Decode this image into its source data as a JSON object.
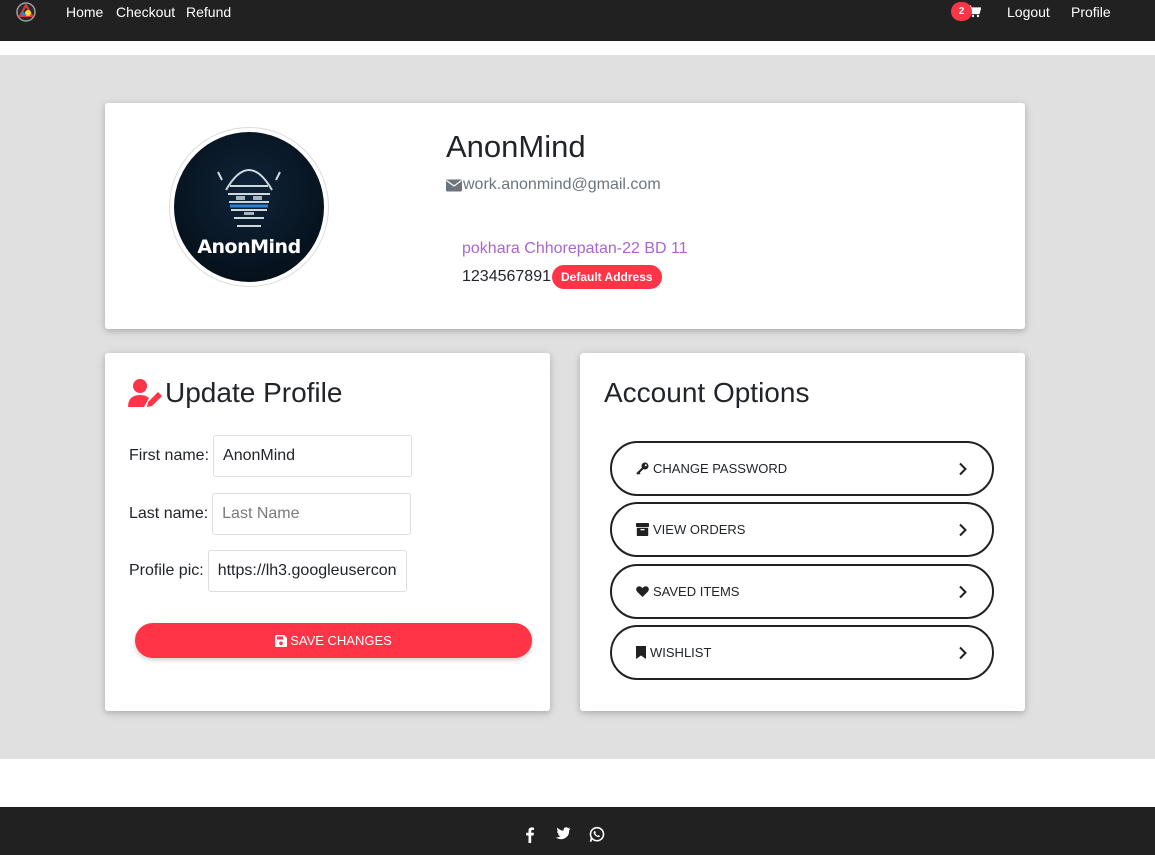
{
  "nav": {
    "logo_icon": "app-logo-icon",
    "links": [
      "Home",
      "Checkout",
      "Refund"
    ],
    "cart_count": "2",
    "cart_icon": "cart-icon",
    "logout": "Logout",
    "profile": "Profile"
  },
  "profile": {
    "avatar_text": "AnonMind",
    "name": "AnonMind",
    "email": "work.anonmind@gmail.com",
    "address": "pokhara Chhorepatan-22 BD 11",
    "phone": "1234567891",
    "badge": "Default Address"
  },
  "update": {
    "title": "Update Profile",
    "first_label": "First name:",
    "first_value": "AnonMind",
    "last_label": "Last name:",
    "last_placeholder": "Last Name",
    "pic_label": "Profile pic:",
    "pic_value": "https://lh3.googleusercontent.com",
    "save": "Save Changes"
  },
  "options": {
    "title": "Account Options",
    "items": [
      {
        "label": "Change Password",
        "icon": "key-icon"
      },
      {
        "label": "View Orders",
        "icon": "box-icon"
      },
      {
        "label": "Saved Items",
        "icon": "heart-icon"
      },
      {
        "label": "Wishlist",
        "icon": "bookmark-icon"
      }
    ]
  },
  "footer": {
    "icons": [
      "facebook-icon",
      "twitter-icon",
      "whatsapp-icon"
    ]
  },
  "colors": {
    "nav": "#212121",
    "accent": "#ff3547",
    "address": "#aa66cc",
    "background": "#e0e0e0"
  }
}
